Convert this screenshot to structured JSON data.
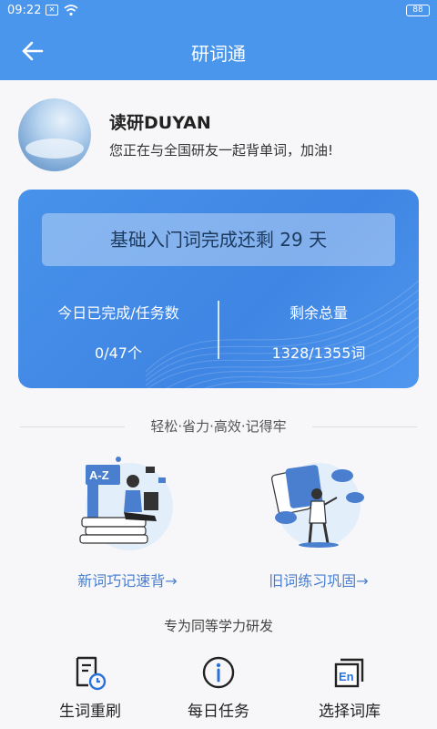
{
  "status_bar": {
    "time": "09:22",
    "battery": "88"
  },
  "nav": {
    "title": "研词通"
  },
  "profile": {
    "name": "读研DUYAN",
    "greeting": "您正在与全国研友一起背单词，加油!"
  },
  "stats": {
    "countdown": "基础入门词完成还剩 29 天",
    "today_label": "今日已完成/任务数",
    "today_value": "0/47个",
    "remaining_label": "剩余总量",
    "remaining_value": "1328/1355词"
  },
  "slogan": "轻松·省力·高效·记得牢",
  "features": [
    {
      "label": "新词巧记速背→",
      "icon": "new-words-illustration"
    },
    {
      "label": "旧词练习巩固→",
      "icon": "review-words-illustration"
    }
  ],
  "subtitle": "专为同等学力研发",
  "tools": [
    {
      "label": "生词重刷",
      "icon": "clock-document-icon"
    },
    {
      "label": "每日任务",
      "icon": "info-icon"
    },
    {
      "label": "选择词库",
      "icon": "en-library-icon"
    }
  ],
  "colors": {
    "primary": "#4a96ec",
    "card": "#4892ea",
    "link": "#4a7fcf"
  }
}
